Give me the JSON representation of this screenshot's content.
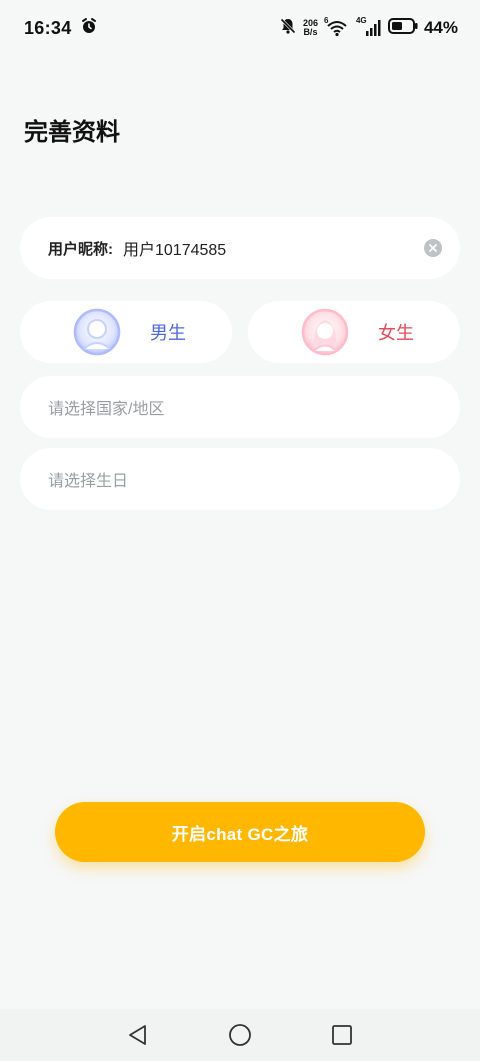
{
  "status_bar": {
    "time": "16:34",
    "net_speed_value": "206",
    "net_speed_unit": "B/s",
    "wifi_label": "6",
    "cell_label": "4G",
    "battery_percent": "44%"
  },
  "page": {
    "title": "完善资料"
  },
  "nickname": {
    "label": "用户昵称:",
    "value": "用户10174585"
  },
  "gender": {
    "male_label": "男生",
    "female_label": "女生"
  },
  "country": {
    "placeholder": "请选择国家/地区"
  },
  "birthday": {
    "placeholder": "请选择生日"
  },
  "actions": {
    "start_label": "开启chat GC之旅"
  },
  "colors": {
    "accent": "#ffb700",
    "male": "#4f68d8",
    "female": "#e4485a",
    "background": "#f6f7f7"
  },
  "icons": {
    "alarm": "alarm-icon",
    "mute": "bell-off-icon",
    "wifi": "wifi-icon",
    "signal": "signal-icon",
    "battery": "battery-icon",
    "clear": "clear-icon",
    "male_avatar": "male-avatar-icon",
    "female_avatar": "female-avatar-icon",
    "back": "back-icon",
    "home": "home-icon",
    "recents": "recents-icon"
  }
}
